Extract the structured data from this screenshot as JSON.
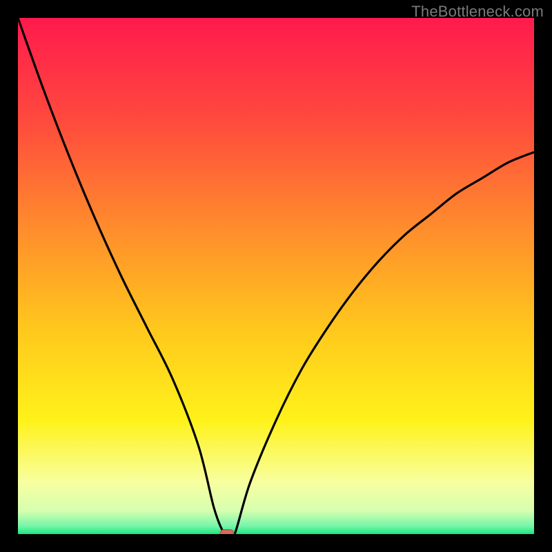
{
  "watermark": "TheBottleneck.com",
  "chart_data": {
    "type": "line",
    "title": "",
    "xlabel": "",
    "ylabel": "",
    "xlim": [
      0,
      100
    ],
    "ylim": [
      0,
      100
    ],
    "grid": false,
    "series": [
      {
        "name": "bottleneck-curve",
        "x": [
          0,
          5,
          10,
          15,
          20,
          25,
          30,
          35,
          38,
          40,
          41,
          42,
          45,
          50,
          55,
          60,
          65,
          70,
          75,
          80,
          85,
          90,
          95,
          100
        ],
        "y": [
          100,
          86,
          73,
          61,
          50,
          40,
          30,
          17,
          5,
          0,
          0,
          0,
          10,
          22,
          32,
          40,
          47,
          53,
          58,
          62,
          66,
          69,
          72,
          74
        ]
      }
    ],
    "marker": {
      "x": 40.5,
      "y": 0
    },
    "background_gradient": {
      "stops": [
        {
          "offset": 0.0,
          "color": "#ff1a4d"
        },
        {
          "offset": 0.2,
          "color": "#ff4a3d"
        },
        {
          "offset": 0.4,
          "color": "#ff8a2d"
        },
        {
          "offset": 0.6,
          "color": "#ffc71d"
        },
        {
          "offset": 0.78,
          "color": "#fff21a"
        },
        {
          "offset": 0.9,
          "color": "#f8ffa0"
        },
        {
          "offset": 0.955,
          "color": "#d6ffb0"
        },
        {
          "offset": 0.985,
          "color": "#74f5a8"
        },
        {
          "offset": 1.0,
          "color": "#17e880"
        }
      ]
    },
    "colors": {
      "curve": "#000000",
      "marker_fill": "#d46a5f",
      "marker_stroke": "#b04f45",
      "frame": "#000000"
    }
  }
}
